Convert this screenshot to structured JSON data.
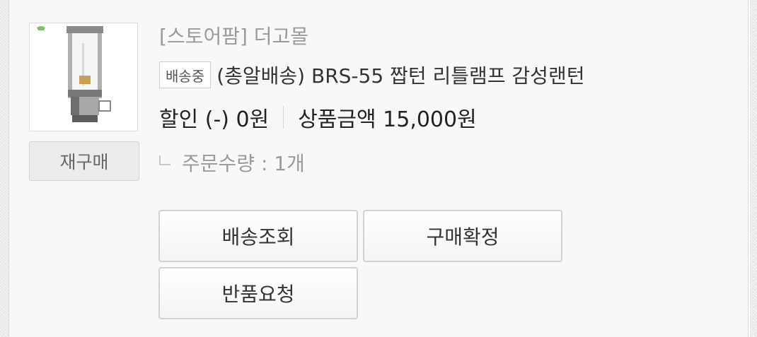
{
  "order_item": {
    "seller": "[스토어팜] 더고몰",
    "status_badge": "배송중",
    "product_name": "(총알배송) BRS-55 짭턴 리틀램프 감성랜턴",
    "discount_text": "할인 (-) 0원",
    "price_text": "상품금액 15,000원",
    "quantity_text": "주문수량 : 1개",
    "rebuy_label": "재구매",
    "product_image_icon": "gas-lantern-icon"
  },
  "actions": {
    "track_label": "배송조회",
    "confirm_label": "구매확정",
    "return_label": "반품요청"
  }
}
